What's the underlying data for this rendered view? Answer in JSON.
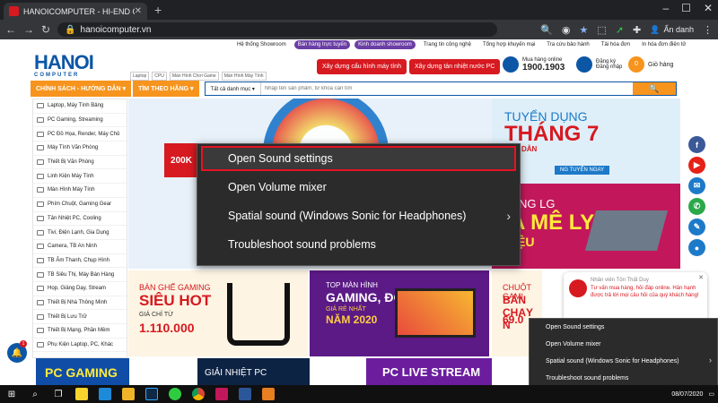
{
  "browser": {
    "tab_title": "HANOICOMPUTER - HI-END COMPUTER",
    "url": "hanoicomputer.vn",
    "profile_label": "Ẩn danh",
    "new_tab": "+",
    "tab_close": "✕"
  },
  "site": {
    "logo_main": "HANOI",
    "logo_sub": "COMPUTER",
    "top_nav": [
      "Hệ thống Showroom",
      "Bán hàng trực tuyến",
      "Kinh doanh showroom",
      "Trang tin công nghệ",
      "Tổng hợp khuyến mại",
      "Tra cứu bảo hành",
      "Tải hóa đơn",
      "In hóa đơn điện tử"
    ],
    "quick_links": [
      "Laptop",
      "CPU",
      "Màn Hình Chơi Game",
      "Màn Hình Máy Tính"
    ],
    "btn_build": "Xây dựng cấu hình máy tính",
    "btn_cooling": "Xây dựng tản nhiệt nước PC",
    "hotline_label": "Mua hàng online",
    "hotline_number": "1900.1903",
    "login": "Đăng ký",
    "login2": "Đăng nhập",
    "cart": "Giỏ hàng",
    "cart_count": "0",
    "cat_menu": "CHÍNH SÁCH - HƯỚNG DẪN ▾",
    "find_menu": "TÌM THEO HÃNG ▾",
    "search_cat": "Tất cả danh mục ▾",
    "search_placeholder": "Nhập tên sản phẩm, từ khóa cần tìm"
  },
  "sidebar": [
    "Laptop, Máy Tính Bảng",
    "PC Gaming, Streaming",
    "PC Đồ Họa, Render, Máy Chủ",
    "Máy Tính Văn Phòng",
    "Thiết Bị Văn Phòng",
    "Linh Kiện Máy Tính",
    "Màn Hình Máy Tính",
    "Phím Chuột, Gaming Gear",
    "Tản Nhiệt PC, Cooling",
    "Tivi, Điện Lạnh, Gia Dụng",
    "Camera, TB An Ninh",
    "TB Âm Thanh, Chụp Hình",
    "TB Siêu Thị, Máy Bán Hàng",
    "Họp, Giảng Dạy, Stream",
    "Thiết Bị Nhà Thông Minh",
    "Thiết Bị Lưu Trữ",
    "Thiết Bị Mạng, Phần Mềm",
    "Phụ Kiện Laptop, PC, Khác"
  ],
  "banners": {
    "main_tag": "200K",
    "recruit_title": "TUYỂN DỤNG",
    "recruit_month": "THÁNG 7",
    "recruit_sub": "HẤP DẪN",
    "recruit_btn": "NG TUYỂN NGAY",
    "lg_t1": "NG LG",
    "lg_t2": "A MÊ LY",
    "lg_t3": "RIỆU",
    "chair_a": "BÀN GHẾ GAMING",
    "chair_b": "SIÊU HOT",
    "chair_c": "GIÁ CHỈ TỪ",
    "chair_d": "1.110.000",
    "mon_a": "TOP MÀN HÌNH",
    "mon_b": "GAMING, ĐỒ HỌA",
    "mon_c": "GIÁ RẺ NHẤT",
    "mon_d": "NĂM 2020",
    "chair2_a": "CHUỘT GAMI",
    "chair2_b": "BÁN CHẠY N",
    "chair2_c": "69.0",
    "pc": "PC GAMING",
    "cool": "GIẢI NHIỆT PC",
    "live": "PC LIVE STREAM"
  },
  "chat": {
    "name": "Nhân viên Tôn Thất Duy",
    "message": "Tư vấn mua hàng, hỏi đáp online. Hân hạnh được trả lời mọi câu hỏi của quý khách hàng!",
    "close": "✕"
  },
  "bell_badge": "1",
  "context_menu": [
    "Open Sound settings",
    "Open Volume mixer",
    "Spatial sound (Windows Sonic for Headphones)",
    "Troubleshoot sound problems"
  ],
  "context_menu_small": [
    "Open Sound settings",
    "Open Volume mixer",
    "Spatial sound (Windows Sonic for Headphones)",
    "Troubleshoot sound problems"
  ],
  "taskbar": {
    "date": "08/07/2020"
  },
  "colors": {
    "accent": "#d71920",
    "brand": "#0c56a6",
    "orange": "#f7941d"
  }
}
